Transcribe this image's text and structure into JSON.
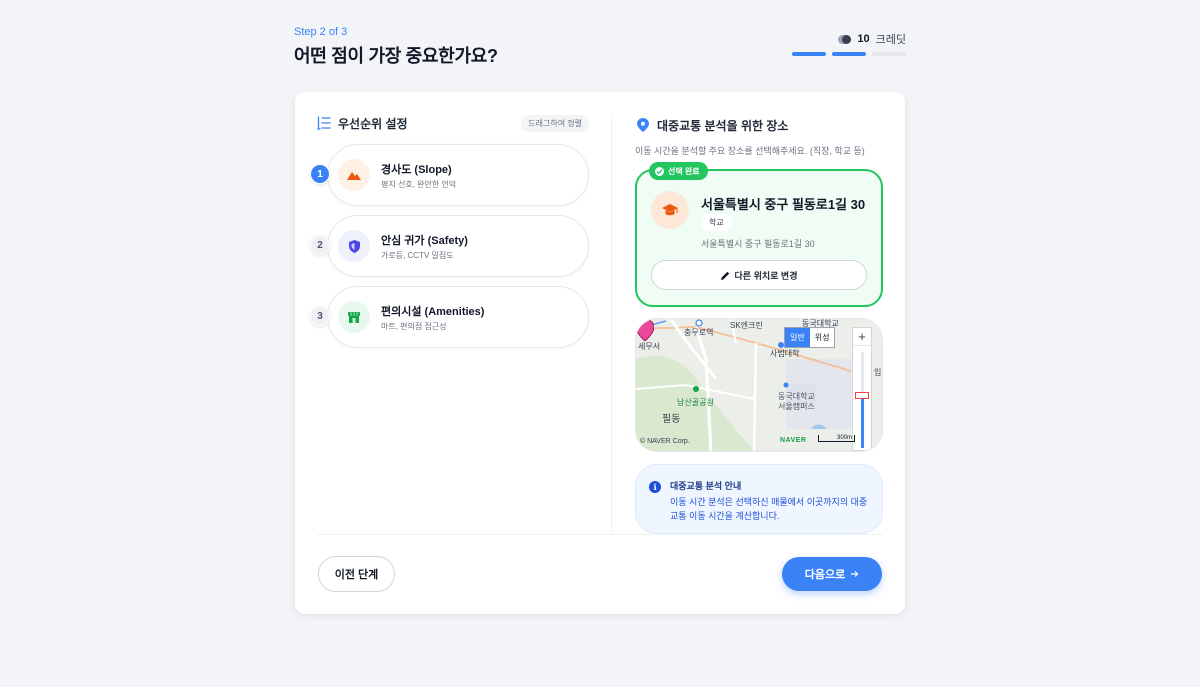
{
  "header": {
    "step": "Step 2 of 3",
    "title": "어떤 점이 가장 중요한가요?",
    "credit_count": "10",
    "credit_label": "크레딧",
    "progress": [
      true,
      true,
      false
    ]
  },
  "left": {
    "title": "우선순위 설정",
    "drag_hint": "드래그하여 정렬",
    "items": [
      {
        "rank": "1",
        "name": "경사도 (Slope)",
        "desc": "평지 선호, 완만한 언덕",
        "icon": "mountain-icon",
        "icon_bg": "#fff1e6",
        "icon_color": "#ea580c"
      },
      {
        "rank": "2",
        "name": "안심 귀가 (Safety)",
        "desc": "가로등, CCTV 밀집도",
        "icon": "shield-icon",
        "icon_bg": "#eef0fb",
        "icon_color": "#4f46e5"
      },
      {
        "rank": "3",
        "name": "편의시설 (Amenities)",
        "desc": "마트, 편의점 접근성",
        "icon": "store-icon",
        "icon_bg": "#e9f8ef",
        "icon_color": "#16a34a"
      }
    ]
  },
  "right": {
    "title": "대중교통 분석을 위한 장소",
    "subtitle": "이동 시간을 분석할 주요 장소를 선택해주세요. (직장, 학교 등)",
    "selected": {
      "badge": "선택 완료",
      "address": "서울특별시 중구 필동로1길 30",
      "tag": "학교",
      "sub_address": "서울특별시 중구 필동로1길 30",
      "change_label": "다른 위치로 변경"
    },
    "map": {
      "type_normal": "일반",
      "type_satellite": "위성",
      "zoom_in": "+",
      "labels": {
        "chungmuro": "충무로역",
        "sk": "SK엔크린",
        "donguk_top": "동국대학교",
        "sabeom": "사범대학",
        "seum": "세무서",
        "namsan": "남산골공원",
        "pildong": "필동",
        "dongguk": "동국대학교",
        "campus": "서울캠퍼스",
        "exit": "입"
      },
      "copyright": "© NAVER Corp.",
      "logo": "NAVER",
      "scale": "300m",
      "zoom_level": 0.55
    },
    "info": {
      "title": "대중교통 분석 안내",
      "body": "이동 시간 분석은 선택하신 매물에서 이곳까지의 대중교통 이동 시간을 계산합니다."
    }
  },
  "footer": {
    "prev_label": "이전 단계",
    "next_label": "다음으로"
  },
  "colors": {
    "accent": "#3b82f6",
    "success": "#22c55e",
    "marker": "#ec4899"
  }
}
